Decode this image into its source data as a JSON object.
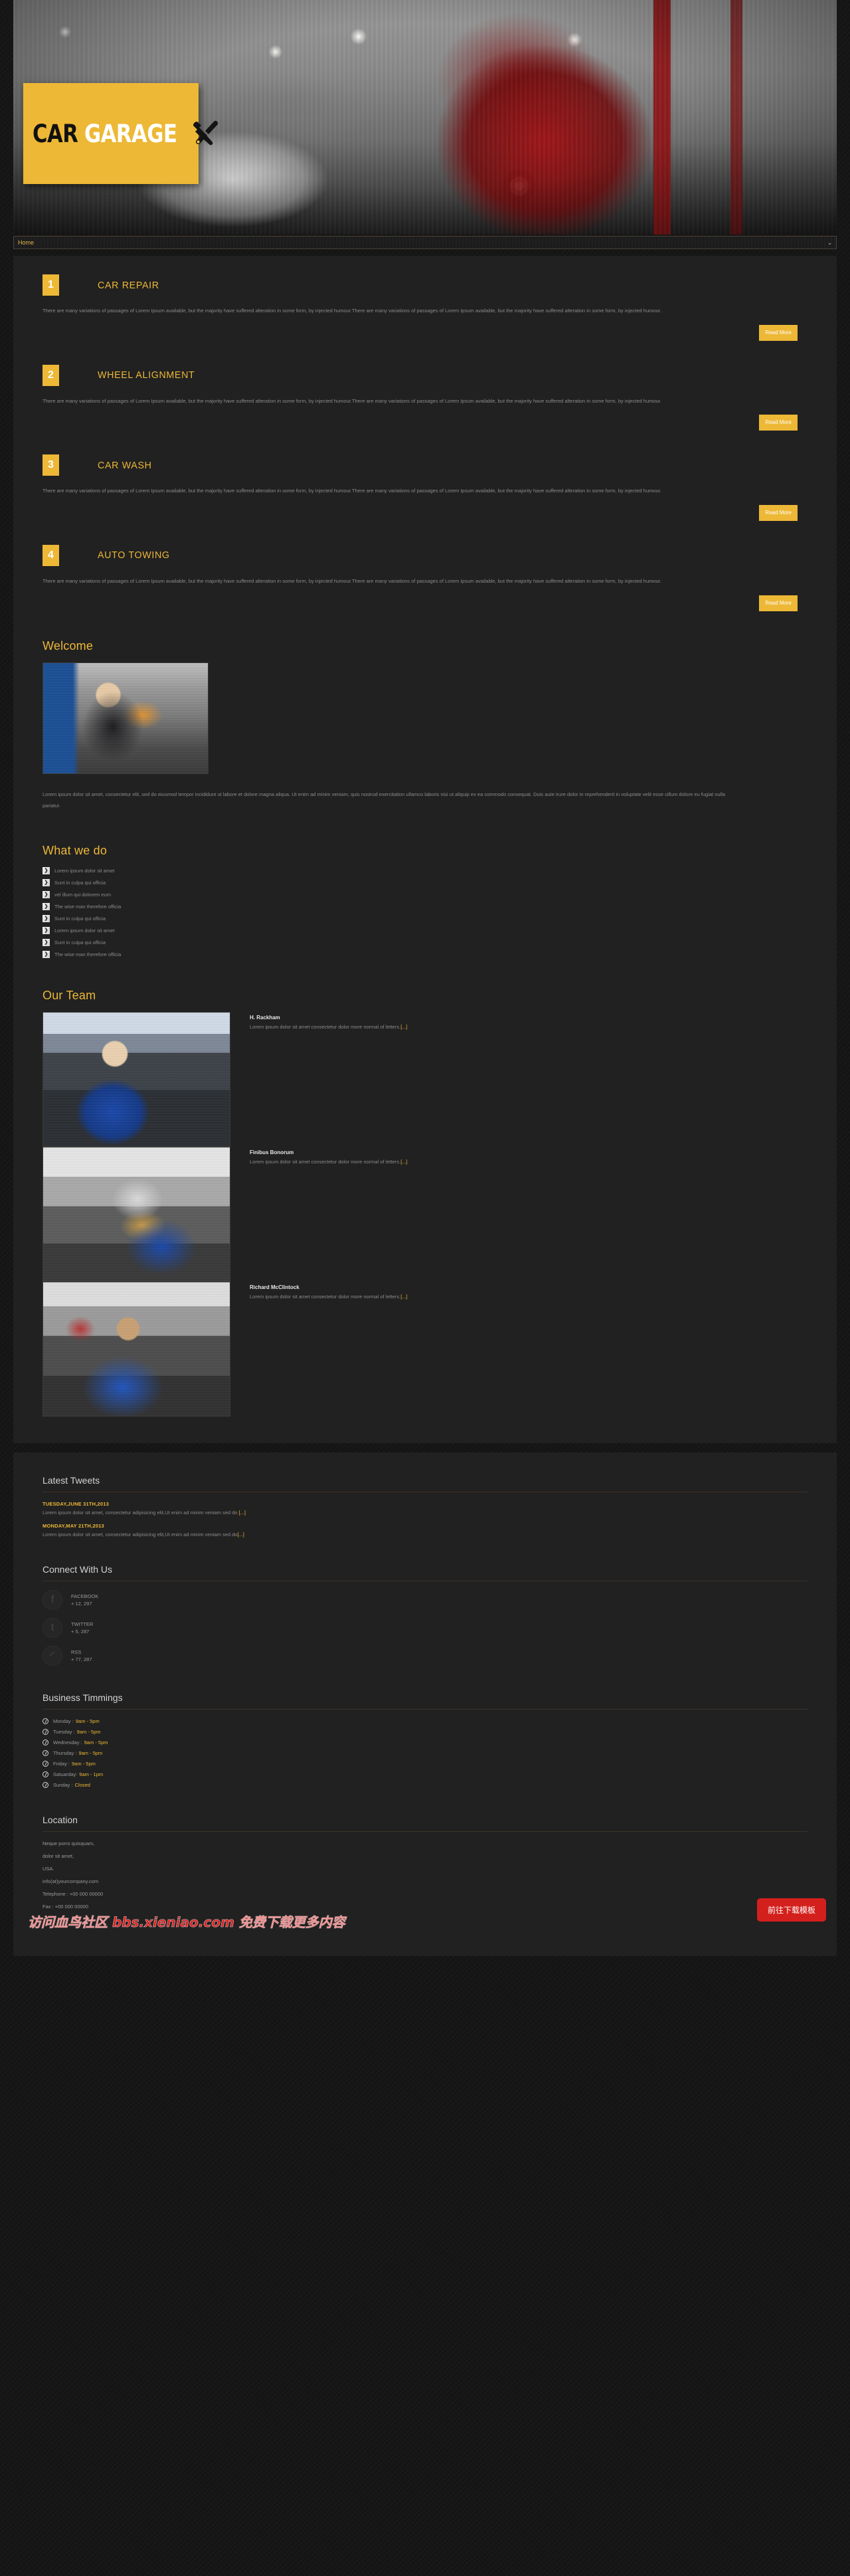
{
  "header": {
    "logo_car": "CAR",
    "logo_garage": "GARAGE",
    "tools_icon": "wrench-screwdriver-icon"
  },
  "nav": {
    "selected": "Home",
    "chevron": "⌄",
    "options": [
      "Home"
    ]
  },
  "services": [
    {
      "number": "1",
      "title": "CAR REPAIR",
      "body": "There are many variations of passages of Lorem Ipsum available, but the majority have suffered alteration in some form, by injected humour.There are many variations of passages of Lorem Ipsum available, but the majority have suffered alteration in some form, by injected humour.",
      "button": "Read More"
    },
    {
      "number": "2",
      "title": "WHEEL ALIGNMENT",
      "body": "There are many variations of passages of Lorem Ipsum available, but the majority have suffered alteration in some form, by injected humour.There are many variations of passages of Lorem Ipsum available, but the majority have suffered alteration in some form, by injected humour.",
      "button": "Read More"
    },
    {
      "number": "3",
      "title": "CAR WASH",
      "body": "There are many variations of passages of Lorem Ipsum available, but the majority have suffered alteration in some form, by injected humour.There are many variations of passages of Lorem Ipsum available, but the majority have suffered alteration in some form, by injected humour.",
      "button": "Read More"
    },
    {
      "number": "4",
      "title": "AUTO TOWING",
      "body": "There are many variations of passages of Lorem Ipsum available, but the majority have suffered alteration in some form, by injected humour.There are many variations of passages of Lorem Ipsum available, but the majority have suffered alteration in some form, by injected humour.",
      "button": "Read More"
    }
  ],
  "welcome": {
    "title": "Welcome",
    "image_alt": "mechanic-with-wrench-photo",
    "body": "Lorem ipsum dolor sit amet, consectetur elit, sed do eiusmod tempor incididunt ut labore et dolore magna aliqua. Ut enim ad minim veniam, quis nostrud exercitation ullamco laboris nisi ut aliquip ex ea commodo consequat. Duis aute irure dolor in reprehenderit in voluptate velit esse cillum dolore eu fugiat nulla pariatur."
  },
  "whatwedo": {
    "title": "What we do",
    "bullet": "❯",
    "items": [
      "Lorem ipsum dolor sit amet",
      "Sunt in culpa qui officia",
      "vel illum qui dolorem eum",
      "The wise man therefore officia",
      "Sunt in culpa qui officia",
      "Lorem ipsum dolor sit amet",
      "Sunt in culpa qui officia",
      "The wise man therefore officia"
    ]
  },
  "team": {
    "title": "Our Team",
    "more": "[...]",
    "members": [
      {
        "name": "H. Rackham",
        "desc": "Lorem ipsum dolor sit amet consectetur dolor more normal of letters.",
        "photo_alt": "mechanic-with-laptop-photo"
      },
      {
        "name": "Finibus Bonorum",
        "desc": "Lorem ipsum dolor sit amet consectetur dolor more normal of letters.",
        "photo_alt": "mechanic-under-hood-photo"
      },
      {
        "name": "Richard McClintock",
        "desc": "Lorem ipsum dolor sit amet consectetur dolor more normal of letters.",
        "photo_alt": "mechanic-in-workshop-photo"
      }
    ]
  },
  "tweets": {
    "title": "Latest Tweets",
    "items": [
      {
        "date": "TUESDAY,JUNE 31TH,2013",
        "text": "Lorem ipsum dolor sit amet, consectetur adipisicing elit,Ut enim ad minim veniam sed do ",
        "more": "[...]"
      },
      {
        "date": "MONDAY,MAY 21TH,2013",
        "text": "Lorem ipsum dolor sit amet, consectetur adipisicing elit,Ut enim ad minim veniam sed do",
        "more": "[...]"
      }
    ]
  },
  "connect": {
    "title": "Connect With Us",
    "items": [
      {
        "name": "FACEBOOK",
        "count": "+ 12, 297",
        "glyph": "f",
        "icon": "facebook-icon"
      },
      {
        "name": "TWITTER",
        "count": "+ 5, 287",
        "glyph": "t",
        "icon": "twitter-icon"
      },
      {
        "name": "RSS",
        "count": "+ 77, 287",
        "glyph": "◜",
        "icon": "rss-icon"
      }
    ]
  },
  "hours": {
    "title": "Business Timmings",
    "items": [
      {
        "day": "Monday :",
        "time": "9am - 5pm"
      },
      {
        "day": "Tuesday :",
        "time": "9am - 5pm"
      },
      {
        "day": "Wednesday :",
        "time": "9am - 5pm"
      },
      {
        "day": "Thursday :",
        "time": "9am - 5pm"
      },
      {
        "day": "Friday :",
        "time": "9am - 5pm"
      },
      {
        "day": "Satuarday:",
        "time": "9am - 1pm"
      },
      {
        "day": "Sunday :",
        "time": "Closed"
      }
    ]
  },
  "location": {
    "title": "Location",
    "lines": [
      "Neque porro quisquam,",
      "dolor sit amet,",
      "USA.",
      "info(at)yourcompany.com",
      "Telephone : +00 000 00000",
      "Fax : +00 000 00000"
    ]
  },
  "overlay": {
    "watermark": "访问血鸟社区 bbs.xieniao.com 免费下载更多内容",
    "download_button": "前往下载模板"
  },
  "colors": {
    "accent": "#edb836",
    "panel": "#212121",
    "page_bg": "#141414",
    "body_text": "#8b8b8b",
    "download_red": "#d4201c"
  }
}
